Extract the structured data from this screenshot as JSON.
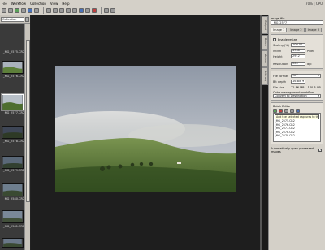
{
  "menu": {
    "items": [
      "File",
      "Workflow",
      "Collection",
      "View",
      "Help"
    ],
    "status": "70% | CPU"
  },
  "left": {
    "collection": "Collection",
    "thumbs": [
      "_MG_2575.CR2",
      "_MG_2576.CR2",
      "_MG_2577.CR2",
      "_MG_2578.CR2",
      "_MG_2579.CR2",
      "_MG_2580.CR2",
      "_MG_2581.CR2"
    ]
  },
  "side_tabs": [
    "Output",
    "Batch",
    "Adjust",
    "Library"
  ],
  "right": {
    "image_file_label": "Image file",
    "image_file": "_MG_2577",
    "tabs": [
      "Image 1",
      "Image 2",
      "Image 3"
    ],
    "enable_resize": "Enable resize",
    "scaling_label": "Scaling (%)",
    "scaling": "100.00",
    "width_label": "Width",
    "width": "4368",
    "height_label": "Height",
    "height": "2912",
    "unit": "Pixel",
    "resolution_label": "Resolution",
    "resolution": "300",
    "res_unit": "dpi",
    "file_format_label": "File format",
    "file_format": "TIFF",
    "bit_depth_label": "Bit depth",
    "bit_depth": "16 Bit",
    "file_size_label": "File size",
    "file_size": "72.86 MB",
    "file_size2": "170.3 GB",
    "color_mgmt_label": "Color management workflow",
    "color_mgmt": "Convert to Destination",
    "batch_label": "Batch Editor",
    "batch_items": [
      "_MG_2575.CR2",
      "_MG_2576.CR2",
      "_MG_2577.CR2",
      "_MG_2578.CR2",
      "_MG_2579.CR2"
    ],
    "tooltip": "Add the selected captures to the batch",
    "auto_open": "Automatically open processed images"
  }
}
